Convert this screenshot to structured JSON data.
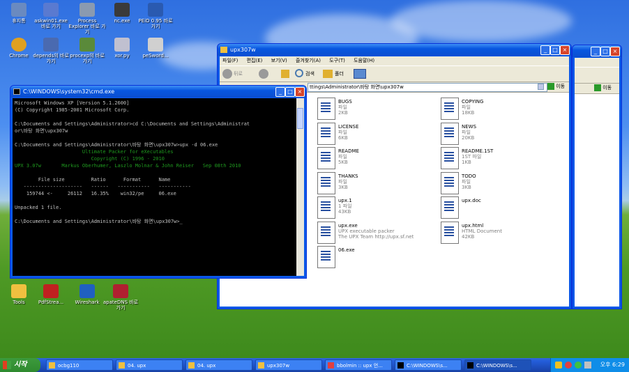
{
  "desktop_icons": [
    {
      "label": "휴지통",
      "color": "#6a8ac0"
    },
    {
      "label": "askwin01.exe 바로 가기",
      "color": "#5a7ad0"
    },
    {
      "label": "Process Explorer 바로 가기",
      "color": "#8a9ab0"
    },
    {
      "label": "nc.exe",
      "color": "#3a3a3a"
    },
    {
      "label": "PEiD 0.95 바로 가기",
      "color": "#2a5ab0"
    },
    {
      "label": "Chrome",
      "color": "#e0a020"
    },
    {
      "label": "depends의 바로 가기",
      "color": "#4a6ab0"
    },
    {
      "label": "procexp의 바로 가기",
      "color": "#5a8a3a"
    },
    {
      "label": "xor.py",
      "color": "#c0c0d0"
    },
    {
      "label": "peSword...",
      "color": "#d0d0d0"
    },
    {
      "label": "Tools",
      "color": "#f0c040"
    },
    {
      "label": "PdfStrea...",
      "color": "#c02020"
    },
    {
      "label": "Wireshark",
      "color": "#2060c0"
    },
    {
      "label": "apateDNS 바로 가기",
      "color": "#b02030"
    }
  ],
  "cmd": {
    "title": "C:\\WINDOWS\\system32\\cmd.exe",
    "lines": [
      "Microsoft Windows XP [Version 5.1.2600]",
      "(C) Copyright 1985-2001 Microsoft Corp.",
      "",
      "C:\\Documents and Settings\\Administrator>cd C:\\Documents and Settings\\Administrat",
      "or\\바탕 화면\\upx307w",
      "",
      "C:\\Documents and Settings\\Administrator\\바탕 화면\\upx307w>upx -d 06.exe",
      "                       Ultimate Packer for eXecutables",
      "                          Copyright (C) 1996 - 2010",
      "UPX 3.07w       Markus Oberhumer, Laszlo Molnar & John Reiser   Sep 08th 2010",
      "",
      "        File size         Ratio      Format      Name",
      "   --------------------   ------   -----------   -----------",
      "    159744 <-     26112   16.35%    win32/pe     06.exe",
      "",
      "Unpacked 1 file.",
      "",
      "C:\\Documents and Settings\\Administrator\\바탕 화면\\upx307w>_"
    ]
  },
  "explorer": {
    "title": "upx307w",
    "menu": [
      "파일(F)",
      "편집(E)",
      "보기(V)",
      "즐겨찾기(A)",
      "도구(T)",
      "도움말(H)"
    ],
    "back_label": "뒤로",
    "search_label": "검색",
    "folders_label": "폴더",
    "address": "ttings\\Administrator\\바탕 화면\\upx307w",
    "go_label": "이동",
    "files": [
      {
        "name": "BUGS",
        "type": "파일",
        "size": "2KB",
        "col": 0
      },
      {
        "name": "COPYING",
        "type": "파일",
        "size": "18KB",
        "col": 1
      },
      {
        "name": "LICENSE",
        "type": "파일",
        "size": "6KB",
        "col": 0
      },
      {
        "name": "NEWS",
        "type": "파일",
        "size": "20KB",
        "col": 1
      },
      {
        "name": "README",
        "type": "파일",
        "size": "5KB",
        "col": 0
      },
      {
        "name": "README.1ST",
        "type": "1ST 파일",
        "size": "1KB",
        "col": 1
      },
      {
        "name": "THANKS",
        "type": "파일",
        "size": "3KB",
        "col": 0
      },
      {
        "name": "TODO",
        "type": "파일",
        "size": "3KB",
        "col": 1
      },
      {
        "name": "upx.1",
        "type": "1 파일",
        "size": "43KB",
        "col": 0
      },
      {
        "name": "upx.doc",
        "type": "",
        "size": "",
        "col": 1
      },
      {
        "name": "upx.exe",
        "type": "UPX executable packer",
        "size": "The UPX Team http://upx.sf.net",
        "col": 0
      },
      {
        "name": "upx.html",
        "type": "HTML Document",
        "size": "42KB",
        "col": 1
      },
      {
        "name": "06.exe",
        "type": "",
        "size": "",
        "col": 0
      }
    ]
  },
  "back_window": {
    "go_label": "이동"
  },
  "taskbar": {
    "start": "시작",
    "tasks": [
      "ocbg110",
      "04. upx",
      "04. upx",
      "upx307w",
      "bbolmin :: upx 언...",
      "C:\\WINDOWS\\s...",
      "C:\\WINDOWS\\s..."
    ],
    "clock": "오후 6:29"
  }
}
